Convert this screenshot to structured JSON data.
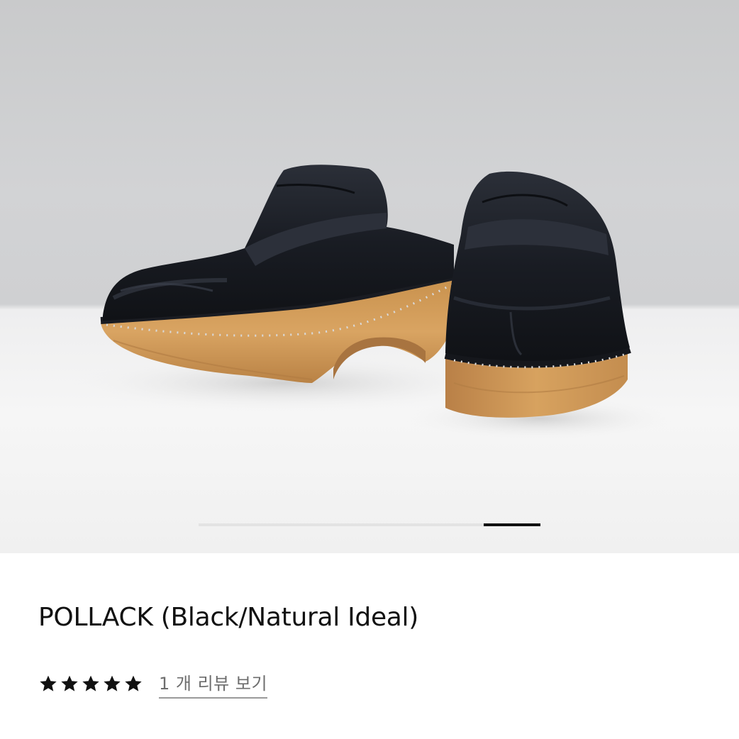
{
  "product": {
    "title": "POLLACK (Black/Natural Ideal)",
    "rating": 5,
    "rating_max": 5,
    "review_link_label": "1 개 리뷰 보기"
  },
  "gallery": {
    "image_subject": "black leather clogs with natural wooden soles",
    "progress": {
      "start_fraction": 0.833,
      "end_fraction": 1.0
    }
  },
  "icons": {
    "star": "star-icon"
  },
  "colors": {
    "text_primary": "#111111",
    "text_secondary": "#6d6d6d",
    "star": "#111111",
    "progress_active": "#111111",
    "progress_track": "#e3e3e3"
  }
}
